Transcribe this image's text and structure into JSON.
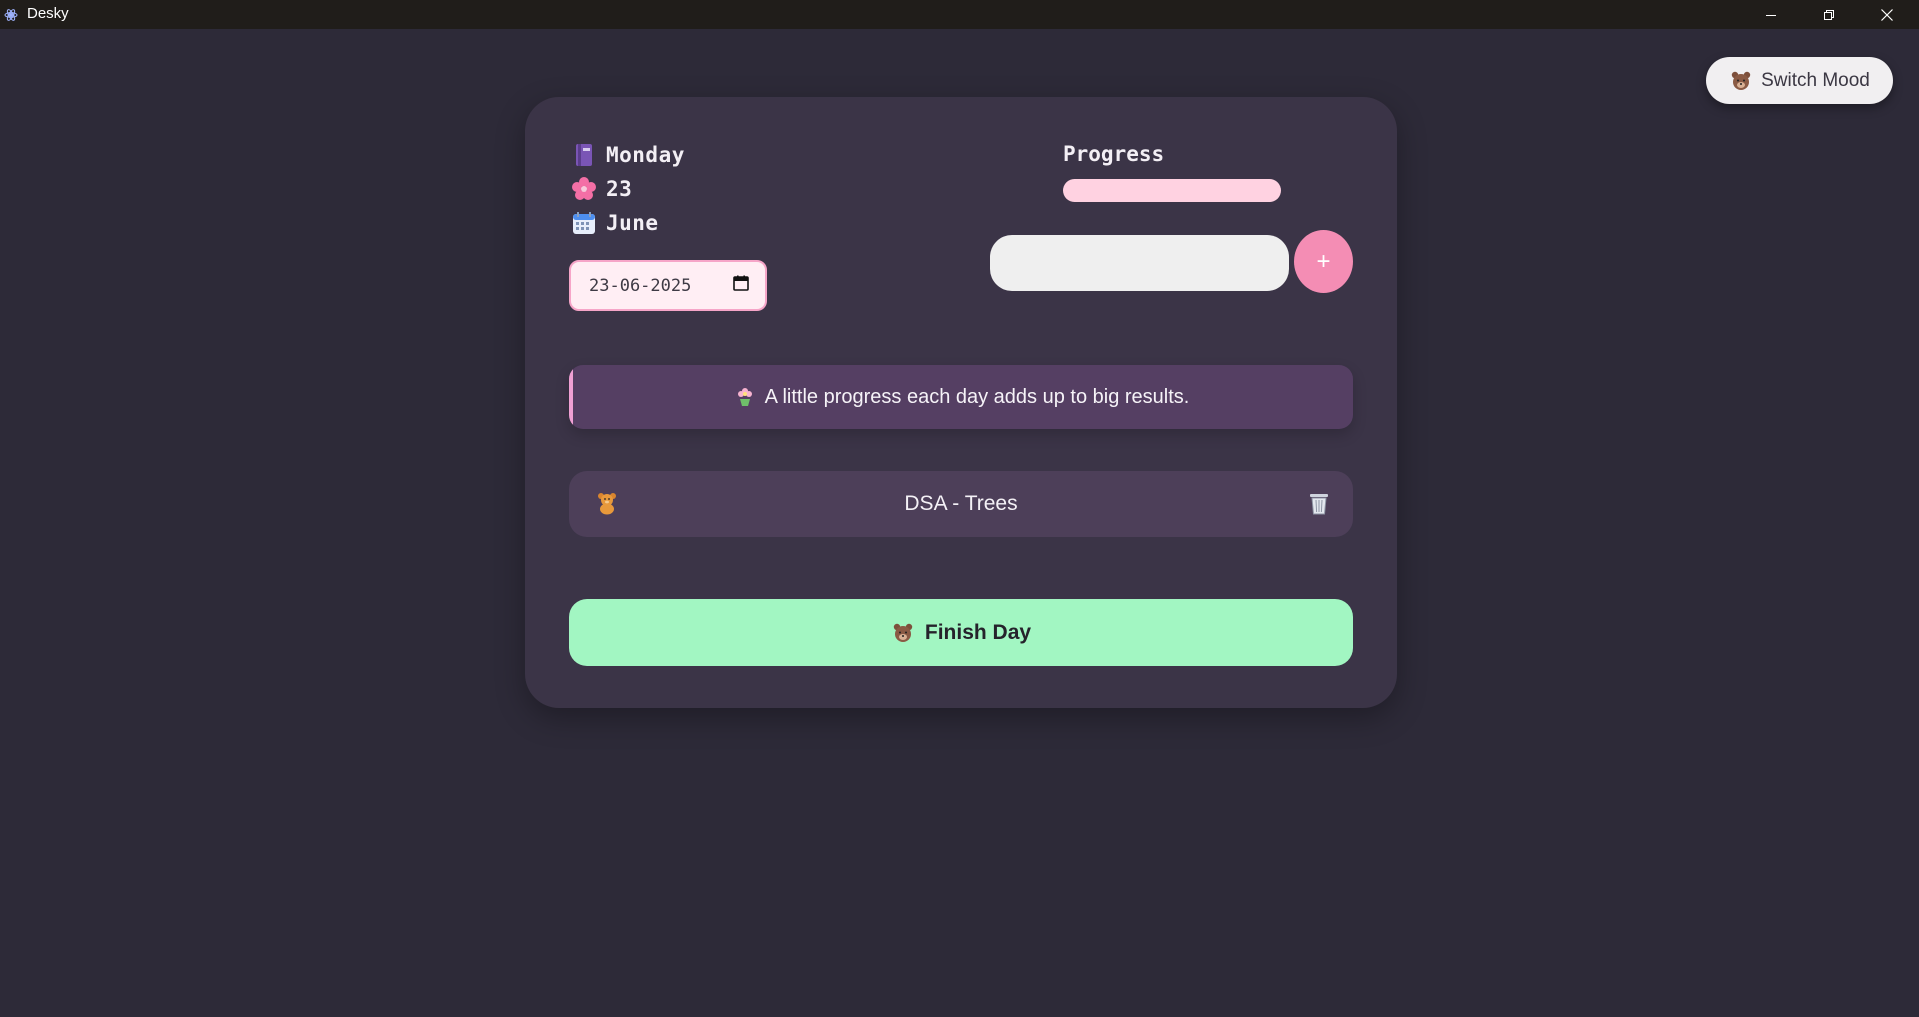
{
  "window": {
    "title": "Desky",
    "minimize_icon": "minimize-icon",
    "maximize_icon": "restore-icon",
    "close_icon": "close-icon"
  },
  "mood_button": {
    "icon": "bear-icon",
    "label": "Switch Mood"
  },
  "date_panel": {
    "day": {
      "icon": "notebook-icon",
      "label": "Monday"
    },
    "date": {
      "icon": "flower-icon",
      "label": "23"
    },
    "month": {
      "icon": "calendar-icon",
      "label": "June"
    },
    "date_value": "23-06-2025"
  },
  "progress": {
    "label": "Progress",
    "value_percent": 0
  },
  "task_entry": {
    "value": "",
    "placeholder": "",
    "add_label": "+"
  },
  "quote": {
    "icon": "flower-pot-icon",
    "text": "A little progress each day adds up to big results."
  },
  "tasks": [
    {
      "icon": "teddy-bear-icon",
      "text": "DSA - Trees",
      "delete_icon": "trash-icon"
    }
  ],
  "finish_button": {
    "icon": "bear-icon",
    "label": "Finish Day"
  },
  "colors": {
    "background": "#2d2a38",
    "card": "#3b3447",
    "accent_pink": "#f48db4",
    "progress_track": "#ffd2e1",
    "finish_green": "#a2f6c2",
    "quote_bg": "#553f63",
    "task_bg": "#4d3f59"
  }
}
